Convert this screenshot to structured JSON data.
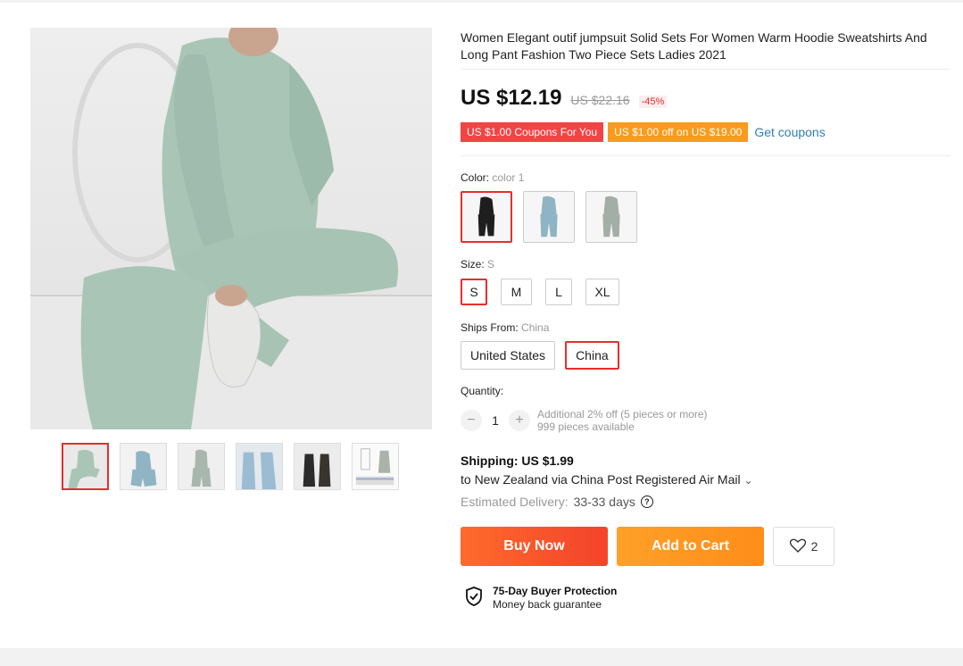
{
  "product": {
    "title": "Women Elegant outif jumpsuit Solid Sets For Women Warm Hoodie Sweatshirts And Long Pant Fashion Two Piece Sets Ladies 2021",
    "price": "US $12.19",
    "original_price": "US $22.16",
    "discount": "-45%"
  },
  "coupons": {
    "coupon1": "US $1.00 Coupons For You",
    "coupon2": "US $1.00 off on US $19.00",
    "get_coupons": "Get coupons"
  },
  "color": {
    "label": "Color:",
    "value": "color 1"
  },
  "size": {
    "label": "Size:",
    "value": "S",
    "options": [
      "S",
      "M",
      "L",
      "XL"
    ]
  },
  "ships_from": {
    "label": "Ships From:",
    "value": "China",
    "options": [
      "United States",
      "China"
    ]
  },
  "quantity": {
    "label": "Quantity:",
    "minus": "−",
    "value": "1",
    "plus": "+",
    "discount_note": "Additional 2% off (5 pieces or more)",
    "available": "999 pieces available"
  },
  "shipping": {
    "title": "Shipping: US $1.99",
    "description": "to New Zealand via China Post Registered Air Mail",
    "chevron": "⌄",
    "delivery_label": "Estimated Delivery:",
    "delivery_value": "33-33 days",
    "help": "?"
  },
  "actions": {
    "buy_now": "Buy Now",
    "add_to_cart": "Add to Cart",
    "wishlist_count": "2"
  },
  "protection": {
    "title": "75-Day Buyer Protection",
    "subtitle": "Money back guarantee"
  },
  "colors": {
    "accent_red": "#e62e2e",
    "buy_now": "#f3432c",
    "add_to_cart": "#ff8d1a",
    "coupon_red": "#f24444",
    "coupon_orange": "#f99b1c",
    "link_blue": "#2f7fb6",
    "sage_green": "#a9c5b6"
  }
}
